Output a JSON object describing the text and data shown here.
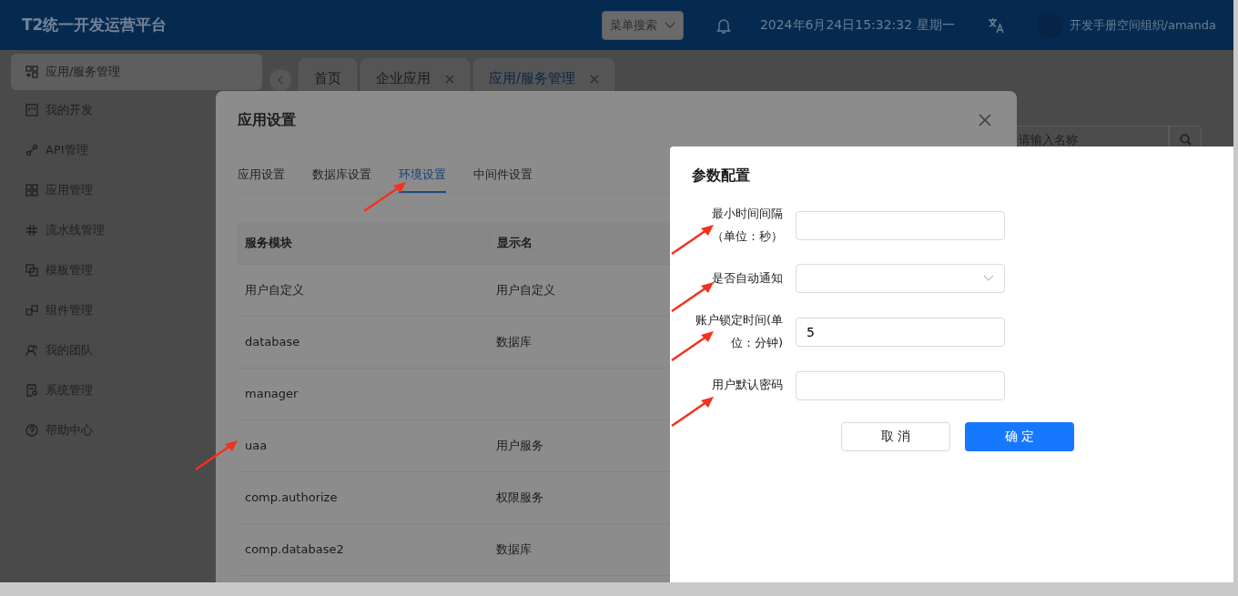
{
  "header": {
    "title": "T2统一开发运营平台",
    "menu_search": "菜单搜索",
    "datetime": "2024年6月24日15:32:32 星期一",
    "user": "开发手册空间组织/amanda"
  },
  "sidebar": {
    "items": [
      {
        "label": "应用/服务管理",
        "selected": true
      },
      {
        "label": "我的开发",
        "selected": false
      },
      {
        "label": "API管理",
        "selected": false
      },
      {
        "label": "应用管理",
        "selected": false
      },
      {
        "label": "流水线管理",
        "selected": false
      },
      {
        "label": "模板管理",
        "selected": false
      },
      {
        "label": "组件管理",
        "selected": false
      },
      {
        "label": "我的团队",
        "selected": false
      },
      {
        "label": "系统管理",
        "selected": false
      },
      {
        "label": "帮助中心",
        "selected": false
      }
    ]
  },
  "page_tabs": [
    {
      "label": "首页",
      "closable": false,
      "selected": false
    },
    {
      "label": "企业应用",
      "closable": true,
      "selected": false
    },
    {
      "label": "应用/服务管理",
      "closable": true,
      "selected": true
    }
  ],
  "search": {
    "placeholder": "请输入名称"
  },
  "app_settings_dialog": {
    "title": "应用设置",
    "tabs": [
      {
        "label": "应用设置",
        "selected": false,
        "arrow": false
      },
      {
        "label": "数据库设置",
        "selected": false,
        "arrow": false
      },
      {
        "label": "环境设置",
        "selected": true,
        "arrow": true
      },
      {
        "label": "中间件设置",
        "selected": false,
        "arrow": false
      }
    ],
    "table": {
      "columns": [
        "服务模块",
        "显示名"
      ],
      "rows": [
        {
          "cells": [
            "用户自定义",
            "用户自定义"
          ],
          "arrow": false
        },
        {
          "cells": [
            "database",
            "数据库"
          ],
          "arrow": false
        },
        {
          "cells": [
            "manager",
            null
          ],
          "arrow": false
        },
        {
          "cells": [
            "uaa",
            "用户服务"
          ],
          "arrow": true
        },
        {
          "cells": [
            "comp.authorize",
            "权限服务"
          ],
          "arrow": false
        },
        {
          "cells": [
            "comp.database2",
            "数据库"
          ],
          "arrow": false
        }
      ]
    }
  },
  "param_dialog": {
    "title": "参数配置",
    "fields": [
      {
        "label": "最小时间间隔（单位：秒）",
        "kind": "input",
        "arrow": true
      },
      {
        "label": "是否自动通知",
        "kind": "select",
        "arrow": true
      },
      {
        "label": "账户锁定时间(单位：分钟)",
        "kind": "input",
        "value": "5",
        "arrow": true
      },
      {
        "label": "用户默认密码",
        "kind": "input",
        "arrow": true
      }
    ],
    "buttons": [
      {
        "label": "取 消",
        "kind": "secondary"
      },
      {
        "label": "确 定",
        "kind": "primary"
      }
    ]
  }
}
